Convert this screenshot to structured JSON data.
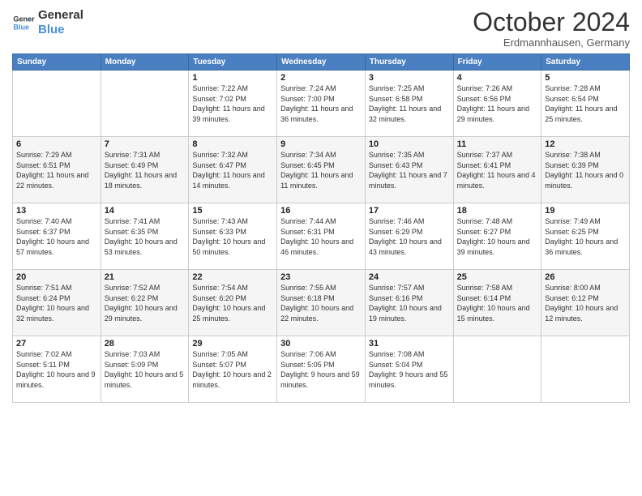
{
  "logo": {
    "text1": "General",
    "text2": "Blue"
  },
  "title": "October 2024",
  "subtitle": "Erdmannhausen, Germany",
  "days_header": [
    "Sunday",
    "Monday",
    "Tuesday",
    "Wednesday",
    "Thursday",
    "Friday",
    "Saturday"
  ],
  "weeks": [
    [
      {
        "day": "",
        "info": ""
      },
      {
        "day": "",
        "info": ""
      },
      {
        "day": "1",
        "info": "Sunrise: 7:22 AM\nSunset: 7:02 PM\nDaylight: 11 hours and 39 minutes."
      },
      {
        "day": "2",
        "info": "Sunrise: 7:24 AM\nSunset: 7:00 PM\nDaylight: 11 hours and 36 minutes."
      },
      {
        "day": "3",
        "info": "Sunrise: 7:25 AM\nSunset: 6:58 PM\nDaylight: 11 hours and 32 minutes."
      },
      {
        "day": "4",
        "info": "Sunrise: 7:26 AM\nSunset: 6:56 PM\nDaylight: 11 hours and 29 minutes."
      },
      {
        "day": "5",
        "info": "Sunrise: 7:28 AM\nSunset: 6:54 PM\nDaylight: 11 hours and 25 minutes."
      }
    ],
    [
      {
        "day": "6",
        "info": "Sunrise: 7:29 AM\nSunset: 6:51 PM\nDaylight: 11 hours and 22 minutes."
      },
      {
        "day": "7",
        "info": "Sunrise: 7:31 AM\nSunset: 6:49 PM\nDaylight: 11 hours and 18 minutes."
      },
      {
        "day": "8",
        "info": "Sunrise: 7:32 AM\nSunset: 6:47 PM\nDaylight: 11 hours and 14 minutes."
      },
      {
        "day": "9",
        "info": "Sunrise: 7:34 AM\nSunset: 6:45 PM\nDaylight: 11 hours and 11 minutes."
      },
      {
        "day": "10",
        "info": "Sunrise: 7:35 AM\nSunset: 6:43 PM\nDaylight: 11 hours and 7 minutes."
      },
      {
        "day": "11",
        "info": "Sunrise: 7:37 AM\nSunset: 6:41 PM\nDaylight: 11 hours and 4 minutes."
      },
      {
        "day": "12",
        "info": "Sunrise: 7:38 AM\nSunset: 6:39 PM\nDaylight: 11 hours and 0 minutes."
      }
    ],
    [
      {
        "day": "13",
        "info": "Sunrise: 7:40 AM\nSunset: 6:37 PM\nDaylight: 10 hours and 57 minutes."
      },
      {
        "day": "14",
        "info": "Sunrise: 7:41 AM\nSunset: 6:35 PM\nDaylight: 10 hours and 53 minutes."
      },
      {
        "day": "15",
        "info": "Sunrise: 7:43 AM\nSunset: 6:33 PM\nDaylight: 10 hours and 50 minutes."
      },
      {
        "day": "16",
        "info": "Sunrise: 7:44 AM\nSunset: 6:31 PM\nDaylight: 10 hours and 46 minutes."
      },
      {
        "day": "17",
        "info": "Sunrise: 7:46 AM\nSunset: 6:29 PM\nDaylight: 10 hours and 43 minutes."
      },
      {
        "day": "18",
        "info": "Sunrise: 7:48 AM\nSunset: 6:27 PM\nDaylight: 10 hours and 39 minutes."
      },
      {
        "day": "19",
        "info": "Sunrise: 7:49 AM\nSunset: 6:25 PM\nDaylight: 10 hours and 36 minutes."
      }
    ],
    [
      {
        "day": "20",
        "info": "Sunrise: 7:51 AM\nSunset: 6:24 PM\nDaylight: 10 hours and 32 minutes."
      },
      {
        "day": "21",
        "info": "Sunrise: 7:52 AM\nSunset: 6:22 PM\nDaylight: 10 hours and 29 minutes."
      },
      {
        "day": "22",
        "info": "Sunrise: 7:54 AM\nSunset: 6:20 PM\nDaylight: 10 hours and 25 minutes."
      },
      {
        "day": "23",
        "info": "Sunrise: 7:55 AM\nSunset: 6:18 PM\nDaylight: 10 hours and 22 minutes."
      },
      {
        "day": "24",
        "info": "Sunrise: 7:57 AM\nSunset: 6:16 PM\nDaylight: 10 hours and 19 minutes."
      },
      {
        "day": "25",
        "info": "Sunrise: 7:58 AM\nSunset: 6:14 PM\nDaylight: 10 hours and 15 minutes."
      },
      {
        "day": "26",
        "info": "Sunrise: 8:00 AM\nSunset: 6:12 PM\nDaylight: 10 hours and 12 minutes."
      }
    ],
    [
      {
        "day": "27",
        "info": "Sunrise: 7:02 AM\nSunset: 5:11 PM\nDaylight: 10 hours and 9 minutes."
      },
      {
        "day": "28",
        "info": "Sunrise: 7:03 AM\nSunset: 5:09 PM\nDaylight: 10 hours and 5 minutes."
      },
      {
        "day": "29",
        "info": "Sunrise: 7:05 AM\nSunset: 5:07 PM\nDaylight: 10 hours and 2 minutes."
      },
      {
        "day": "30",
        "info": "Sunrise: 7:06 AM\nSunset: 5:05 PM\nDaylight: 9 hours and 59 minutes."
      },
      {
        "day": "31",
        "info": "Sunrise: 7:08 AM\nSunset: 5:04 PM\nDaylight: 9 hours and 55 minutes."
      },
      {
        "day": "",
        "info": ""
      },
      {
        "day": "",
        "info": ""
      }
    ]
  ]
}
